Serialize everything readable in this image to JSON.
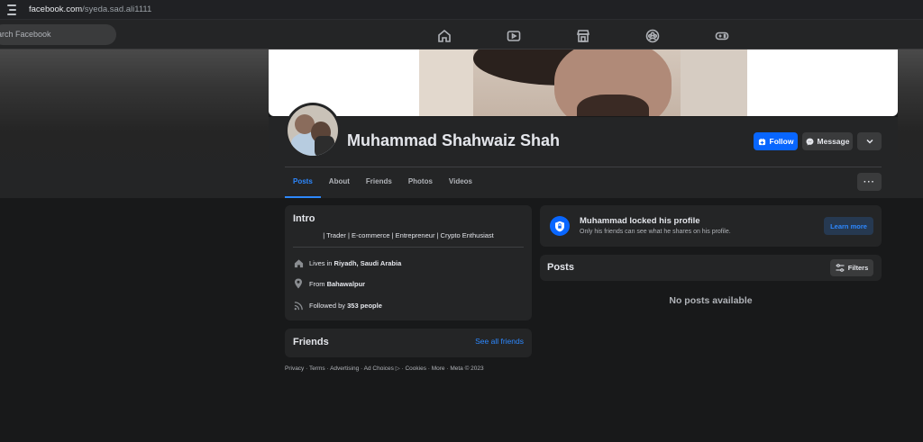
{
  "browser": {
    "url_host": "facebook.com",
    "url_path": "/syeda.sad.ali1111"
  },
  "nav": {
    "search_placeholder": "earch Facebook",
    "icons": [
      "home-icon",
      "video-icon",
      "marketplace-icon",
      "groups-icon",
      "gaming-icon"
    ]
  },
  "profile": {
    "name": "Muhammad Shahwaiz Shah",
    "follow_label": "Follow",
    "message_label": "Message",
    "more_label": "⌄",
    "dots_label": "···"
  },
  "tabs": [
    "Posts",
    "About",
    "Friends",
    "Photos",
    "Videos"
  ],
  "active_tab": "Posts",
  "intro": {
    "title": "Intro",
    "bio": "| Trader | E-commerce | Entrepreneur | Crypto Enthusiast",
    "lives_prefix": "Lives in ",
    "lives_value": "Riyadh, Saudi Arabia",
    "from_prefix": "From ",
    "from_value": "Bahawalpur",
    "followed_prefix": "Followed by ",
    "followed_value": "353 people"
  },
  "friends": {
    "title": "Friends",
    "see_all": "See all friends"
  },
  "footer": "Privacy · Terms · Advertising · Ad Choices ▷ · Cookies · More · Meta © 2023",
  "locked": {
    "title": "Muhammad locked his profile",
    "subtitle": "Only his friends can see what he shares on his profile.",
    "button": "Learn more"
  },
  "posts": {
    "title": "Posts",
    "filters": "Filters",
    "empty": "No posts available"
  },
  "colors": {
    "accent": "#0866ff",
    "link": "#2d88ff",
    "background": "#18191a",
    "card": "#242526"
  }
}
